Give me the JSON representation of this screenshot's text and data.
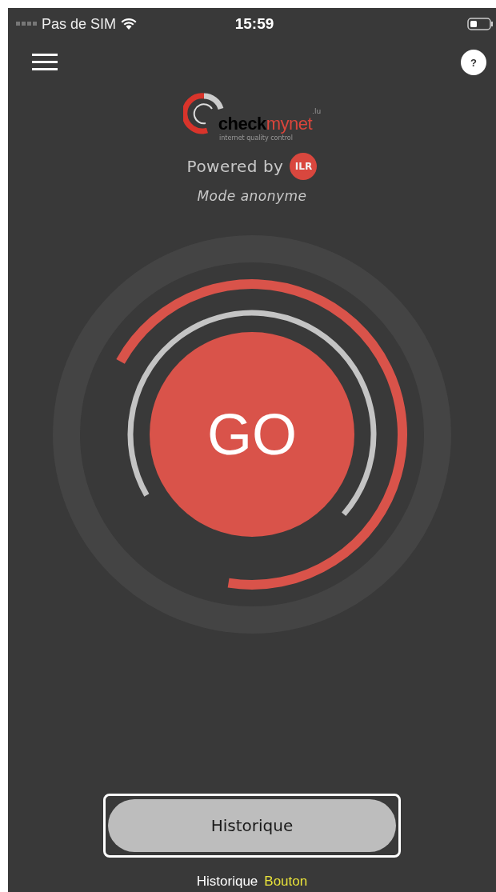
{
  "status_bar": {
    "carrier": "Pas de SIM",
    "time": "15:59"
  },
  "help_button": {
    "label": "?"
  },
  "logo": {
    "word_dark": "check",
    "word_red": "mynet",
    "suffix": ".lu",
    "tagline": "internet quality control"
  },
  "powered_by": {
    "text": "Powered by",
    "badge": "ILR"
  },
  "mode": "Mode anonyme",
  "go_button": {
    "label": "GO"
  },
  "history_button": {
    "label": "Historique",
    "focused": true
  },
  "voiceover_caption": {
    "label": "Historique",
    "role": "Bouton"
  }
}
